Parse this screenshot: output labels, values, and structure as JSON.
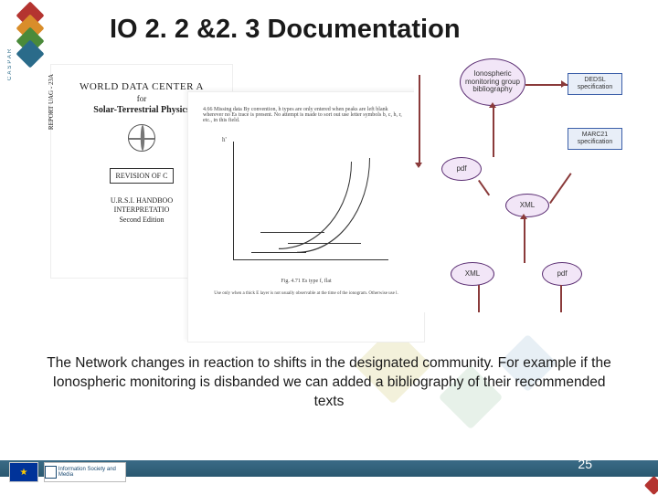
{
  "title": "IO 2. 2 &2. 3 Documentation",
  "caption": "The Network changes in reaction to shifts in the designated community. For example if the Ionospheric monitoring is disbanded we can added a bibliography of their recommended texts",
  "doc_cover": {
    "side_label": "REPORT UAG - 23A",
    "line1": "WORLD DATA CENTER A",
    "line2": "for",
    "line3": "Solar-Terrestrial Physics",
    "revision": "REVISION OF C",
    "handbook1": "U.R.S.I. HANDBOO",
    "handbook2": "INTERPRETATIO",
    "handbook3": "Second Edition"
  },
  "doc_page": {
    "desc": "4.66  Missing data   By convention, h types are only entered when peaks are left blank wherever no Es trace is present.  No attempt is made to sort out use letter symbols b, c, h, r, etc., in this field.",
    "ylabel": "h'",
    "caption": "Fig. 4.71  Es type f, flat",
    "note": "Use only when a thick E layer is not usually observable at the time of the ionogram.  Otherwise use l."
  },
  "diagram": {
    "n_bibliography": "Ionospheric monitoring group bibliography",
    "r_dedsl": "DEDSL specification",
    "r_marc21": "MARC21 specification",
    "n_pdf1": "pdf",
    "n_xml1": "XML",
    "n_xml2": "XML",
    "n_pdf2": "pdf"
  },
  "footer": {
    "logo_text": "Information Society and Media",
    "page_number": "25"
  },
  "brand": "CASPAR"
}
